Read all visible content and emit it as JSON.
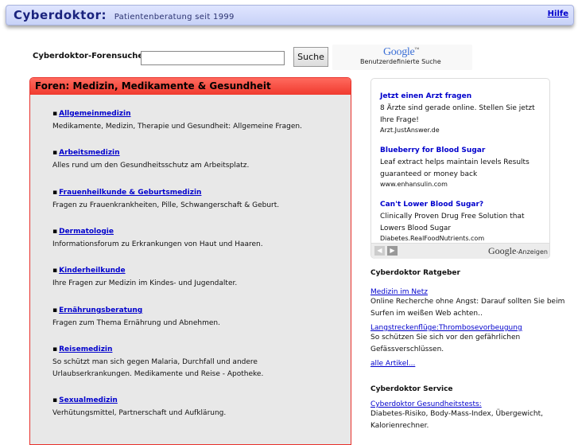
{
  "header": {
    "brand": "Cyberdoktor:",
    "tagline": "Patientenberatung seit 1999",
    "help_link": "Hilfe"
  },
  "search": {
    "label": "Cyberdoktor-Forensuche:",
    "value": "",
    "button": "Suche",
    "google_logo": "Google",
    "google_tm": "™",
    "google_caption": "Benutzerdefinierte Suche"
  },
  "forums": {
    "header": "Foren:  Medizin, Medikamente & Gesundheit",
    "items": [
      {
        "title": "Allgemeinmedizin",
        "desc": "Medikamente, Medizin, Therapie und Gesundheit: Allgemeine Fragen."
      },
      {
        "title": "Arbeitsmedizin",
        "desc": "Alles rund um den Gesundheitsschutz am Arbeitsplatz."
      },
      {
        "title": "Frauenheilkunde & Geburtsmedizin",
        "desc": "Fragen zu Frauenkrankheiten, Pille, Schwangerschaft & Geburt."
      },
      {
        "title": "Dermatologie",
        "desc": "Informationsforum zu Erkrankungen von Haut und Haaren."
      },
      {
        "title": "Kinderheilkunde",
        "desc": "Ihre Fragen zur Medizin im Kindes- und Jugendalter."
      },
      {
        "title": "Ernährungsberatung",
        "desc": "Fragen zum Thema Ernährung und Abnehmen."
      },
      {
        "title": "Reisemedizin",
        "desc": "So schützt man sich gegen Malaria, Durchfall und andere Urlaubserkrankungen. Medikamente und Reise - Apotheke."
      },
      {
        "title": "Sexualmedizin",
        "desc": "Verhütungsmittel, Partnerschaft und Aufklärung."
      }
    ]
  },
  "ads": {
    "items": [
      {
        "title": "Jetzt einen Arzt fragen",
        "text": "8 Ärzte sind gerade online. Stellen Sie jetzt Ihre Frage!",
        "url": "Arzt.JustAnswer.de"
      },
      {
        "title": "Blueberry for Blood Sugar",
        "text": "Leaf extract helps maintain levels Results guaranteed or money back",
        "url": "www.enhansulin.com"
      },
      {
        "title": "Can't Lower Blood Sugar?",
        "text": "Clinically Proven Drug Free Solution that Lowers Blood Sugar",
        "url": "Diabetes.RealFoodNutrients.com"
      }
    ],
    "prev_arrow": "◀",
    "next_arrow": "▶",
    "google_label": "Google",
    "anzeigen_label": "-Anzeigen"
  },
  "ratgeber": {
    "heading": "Cyberdoktor Ratgeber",
    "link1": "Medizin im Netz ",
    "text1": "Online Recherche ohne Angst: Darauf sollten Sie beim Surfen im weißen Web achten..",
    "link2": "Langstreckenflüge:Thrombosevorbeugung",
    "text2": "So schützen Sie sich vor den gefährlichen Gefässverschlüssen.",
    "all_link": "alle Artikel..."
  },
  "service": {
    "heading": "Cyberdoktor Service",
    "link1": "Cyberdoktor Gesundheitstests:",
    "text1": "Diabetes-Risiko, Body-Mass-Index, Übergewicht, Kalorienrechner."
  }
}
